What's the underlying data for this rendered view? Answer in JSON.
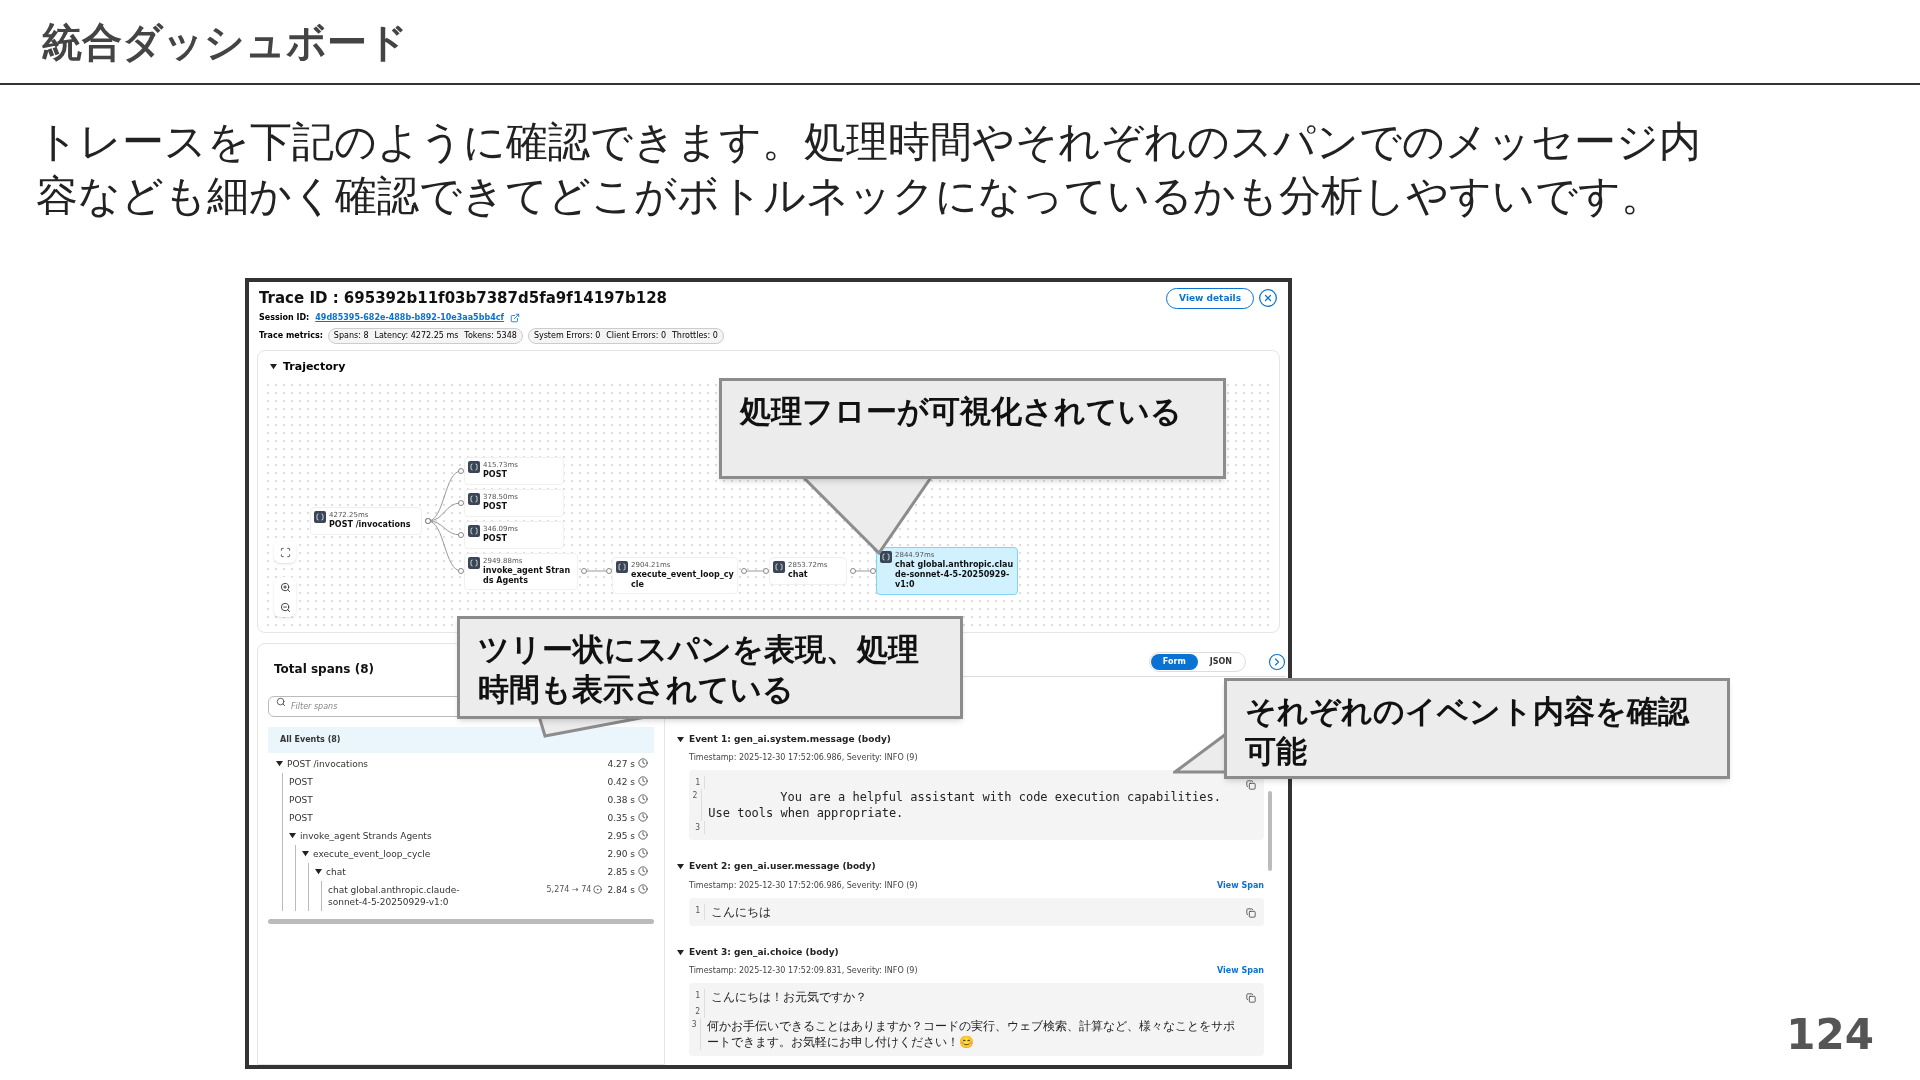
{
  "slide": {
    "title": "統合ダッシュボード",
    "body": "トレースを下記のように確認できます。処理時間やそれぞれのスパンでのメッセージ内容なども細かく確認できてどこがボトルネックになっているかも分析しやすいです。",
    "page_number": "124"
  },
  "trace": {
    "title": "Trace ID : 695392b11f03b7387d5fa9f14197b128",
    "view_details": "View details",
    "session_label": "Session ID:",
    "session_id": "49d85395-682e-488b-b892-10e3aa5bb4cf",
    "metrics_label": "Trace metrics:",
    "metric_groups": [
      [
        "Spans: 8",
        "Latency: 4272.25 ms",
        "Tokens: 5348"
      ],
      [
        "System Errors: 0",
        "Client Errors: 0",
        "Throttles: 0"
      ]
    ]
  },
  "trajectory": {
    "title": "Trajectory",
    "expanded": true,
    "nodes": [
      {
        "duration": "4272.25ms",
        "label": "POST /invocations",
        "selected": false
      },
      {
        "duration": "415.73ms",
        "label": "POST",
        "selected": false
      },
      {
        "duration": "378.50ms",
        "label": "POST",
        "selected": false
      },
      {
        "duration": "346.09ms",
        "label": "POST",
        "selected": false
      },
      {
        "duration": "2949.88ms",
        "label": "invoke_agent Strands Agents",
        "selected": false
      },
      {
        "duration": "2904.21ms",
        "label": "execute_event_loop_cycle",
        "selected": false
      },
      {
        "duration": "2853.72ms",
        "label": "chat",
        "selected": false
      },
      {
        "duration": "2844.97ms",
        "label": "chat global.anthropic.claude-sonnet-4-5-20250929-v1:0",
        "selected": true
      }
    ]
  },
  "spans": {
    "title": "Total spans (8)",
    "filter_placeholder": "Filter spans",
    "all_events": "All Events (8)",
    "tree": [
      {
        "label": "POST /invocations",
        "time": "4.27 s",
        "expanded": true,
        "children": [
          {
            "label": "POST",
            "time": "0.42 s"
          },
          {
            "label": "POST",
            "time": "0.38 s"
          },
          {
            "label": "POST",
            "time": "0.35 s"
          },
          {
            "label": "invoke_agent Strands Agents",
            "time": "2.95 s",
            "expanded": true,
            "children": [
              {
                "label": "execute_event_loop_cycle",
                "time": "2.90 s",
                "expanded": true,
                "children": [
                  {
                    "label": "chat",
                    "time": "2.85 s",
                    "expanded": true,
                    "children": [
                      {
                        "label": "chat global.anthropic.claude-sonnet-4-5-20250929-v1:0",
                        "tokens": "5,274 → 74",
                        "time": "2.84 s"
                      }
                    ]
                  }
                ]
              }
            ]
          }
        ]
      }
    ]
  },
  "events_panel": {
    "view_modes": [
      {
        "label": "Form",
        "selected": true
      },
      {
        "label": "JSON",
        "selected": false
      }
    ],
    "events": [
      {
        "title": "Event 1: gen_ai.system.message (body)",
        "expanded": true,
        "timestamp": "Timestamp: 2025-12-30 17:52:06.986, Severity: INFO (9)",
        "lines": [
          {
            "number": "1"
          },
          {
            "number": "2",
            "text": "You are a helpful assistant with code execution capabilities. Use tools when appropriate.",
            "indented": true
          },
          {
            "number": "3"
          }
        ]
      },
      {
        "title": "Event 2: gen_ai.user.message (body)",
        "expanded": true,
        "timestamp": "Timestamp: 2025-12-30 17:52:06.986, Severity: INFO (9)",
        "view_span": "View Span",
        "lines": [
          {
            "number": "1",
            "text": "こんにちは"
          }
        ]
      },
      {
        "title": "Event 3: gen_ai.choice (body)",
        "expanded": true,
        "timestamp": "Timestamp: 2025-12-30 17:52:09.831, Severity: INFO (9)",
        "view_span": "View Span",
        "lines": [
          {
            "number": "1",
            "text": "こんにちは！お元気ですか？"
          },
          {
            "number": "2"
          },
          {
            "number": "3",
            "text": "何かお手伝いできることはありますか？コードの実行、ウェブ検索、計算など、様々なことをサポートできます。お気軽にお申し付けください！😊"
          }
        ]
      }
    ]
  },
  "callouts": [
    {
      "text": "処理フローが可視化されている"
    },
    {
      "text": "ツリー状にスパンを表現、処理時間も表示されている"
    },
    {
      "text": "それぞれのイベント内容を確認可能"
    }
  ]
}
